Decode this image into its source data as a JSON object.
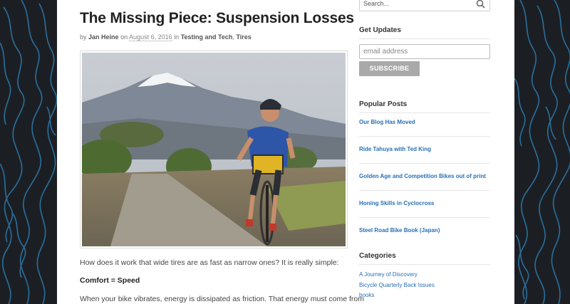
{
  "post": {
    "title": "The Missing Piece: Suspension Losses",
    "by": "by",
    "author": "Jan Heine",
    "on": "on",
    "date": "August 6, 2016",
    "in": "in",
    "category1": "Testing and Tech",
    "comma": ",",
    "category2": "Tires",
    "paragraph1": "How does it work that wide tires are as fast as narrow ones? It is really simple:",
    "paragraph2": "Comfort = Speed",
    "paragraph3": "When your bike vibrates, energy is dissipated as friction. That energy must come from"
  },
  "sidebar": {
    "search_placeholder": "Search...",
    "updates_title": "Get Updates",
    "email_placeholder": "email address",
    "subscribe_label": "SUBSCRIBE",
    "popular_title": "Popular Posts",
    "popular_posts": [
      "Our Blog Has Moved",
      "Ride Tahuya with Ted King",
      "Golden Age and Competition Bikes out of print",
      "Honing Skills in Cyclocross",
      "Steel Road Bike Book (Japan)"
    ],
    "categories_title": "Categories",
    "categories": [
      "A Journey of Discovery",
      "Bicycle Quarterly Back Issues",
      "books"
    ]
  },
  "colors": {
    "link": "#2a6fb5",
    "background": "#1b1f24",
    "pattern": "#2b6f9c"
  }
}
